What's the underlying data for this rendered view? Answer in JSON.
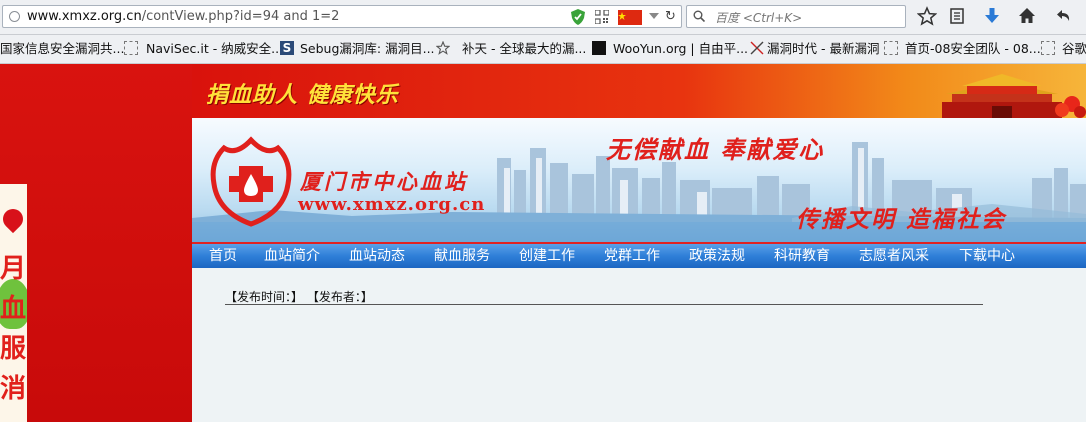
{
  "browser": {
    "url_host": "www.xmxz.org.cn",
    "url_path": "/contView.php?id=94 and 1=2",
    "search_placeholder": "百度 <Ctrl+K>"
  },
  "bookmarks": [
    {
      "label": "国家信息安全漏洞共..."
    },
    {
      "label": "NaviSec.it - 纳威安全..."
    },
    {
      "label": "Sebug漏洞库: 漏洞目..."
    },
    {
      "label": "补天 - 全球最大的漏..."
    },
    {
      "label": "WooYun.org | 自由平..."
    },
    {
      "label": "漏洞时代 - 最新漏洞"
    },
    {
      "label": "首页-08安全团队 - 08..."
    },
    {
      "label": "谷歌"
    }
  ],
  "site": {
    "top_slogan": "捐血助人 健康快乐",
    "org_name": "厦门市中心血站",
    "org_url": "www.xmxz.org.cn",
    "slogan_1": "无偿献血  奉献爱心",
    "slogan_2": "传播文明  造福社会",
    "float_ad_chars": [
      "月",
      "血",
      "服",
      "消"
    ]
  },
  "nav": [
    {
      "label": "首页"
    },
    {
      "label": "血站简介"
    },
    {
      "label": "血站动态"
    },
    {
      "label": "献血服务"
    },
    {
      "label": "创建工作"
    },
    {
      "label": "党群工作"
    },
    {
      "label": "政策法规"
    },
    {
      "label": "科研教育"
    },
    {
      "label": "志愿者风采"
    },
    {
      "label": "下载中心"
    }
  ],
  "article": {
    "meta": "【发布时间：】 【发布者：】"
  },
  "colors": {
    "red": "#d10f0f",
    "nav_blue": "#2f7fd8",
    "content_bg": "#eef3f5"
  }
}
